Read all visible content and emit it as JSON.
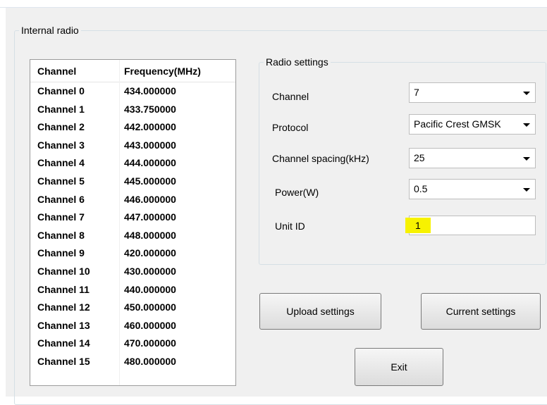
{
  "internal_radio": {
    "title": "Internal radio",
    "table": {
      "headers": [
        "Channel",
        "Frequency(MHz)"
      ],
      "rows": [
        {
          "channel": "Channel 0",
          "frequency": "434.000000"
        },
        {
          "channel": "Channel 1",
          "frequency": "433.750000"
        },
        {
          "channel": "Channel 2",
          "frequency": "442.000000"
        },
        {
          "channel": "Channel 3",
          "frequency": "443.000000"
        },
        {
          "channel": "Channel 4",
          "frequency": "444.000000"
        },
        {
          "channel": "Channel 5",
          "frequency": "445.000000"
        },
        {
          "channel": "Channel 6",
          "frequency": "446.000000"
        },
        {
          "channel": "Channel 7",
          "frequency": "447.000000"
        },
        {
          "channel": "Channel 8",
          "frequency": "448.000000"
        },
        {
          "channel": "Channel 9",
          "frequency": "420.000000"
        },
        {
          "channel": "Channel 10",
          "frequency": "430.000000"
        },
        {
          "channel": "Channel 11",
          "frequency": "440.000000"
        },
        {
          "channel": "Channel 12",
          "frequency": "450.000000"
        },
        {
          "channel": "Channel 13",
          "frequency": "460.000000"
        },
        {
          "channel": "Channel 14",
          "frequency": "470.000000"
        },
        {
          "channel": "Channel 15",
          "frequency": "480.000000"
        }
      ]
    }
  },
  "radio_settings": {
    "title": "Radio settings",
    "channel": {
      "label": "Channel",
      "value": "7"
    },
    "protocol": {
      "label": "Protocol",
      "value": "Pacific Crest GMSK"
    },
    "spacing": {
      "label": "Channel spacing(kHz)",
      "value": "25"
    },
    "power": {
      "label": "Power(W)",
      "value": "0.5"
    },
    "unit_id": {
      "label": "Unit ID",
      "value": "1"
    }
  },
  "buttons": {
    "upload": "Upload settings",
    "current": "Current settings",
    "exit": "Exit"
  },
  "icons": {
    "dropdown": "chevron-down-icon"
  },
  "colors": {
    "panel_bg": "#f0f0f0",
    "highlight": "#f7f200"
  }
}
